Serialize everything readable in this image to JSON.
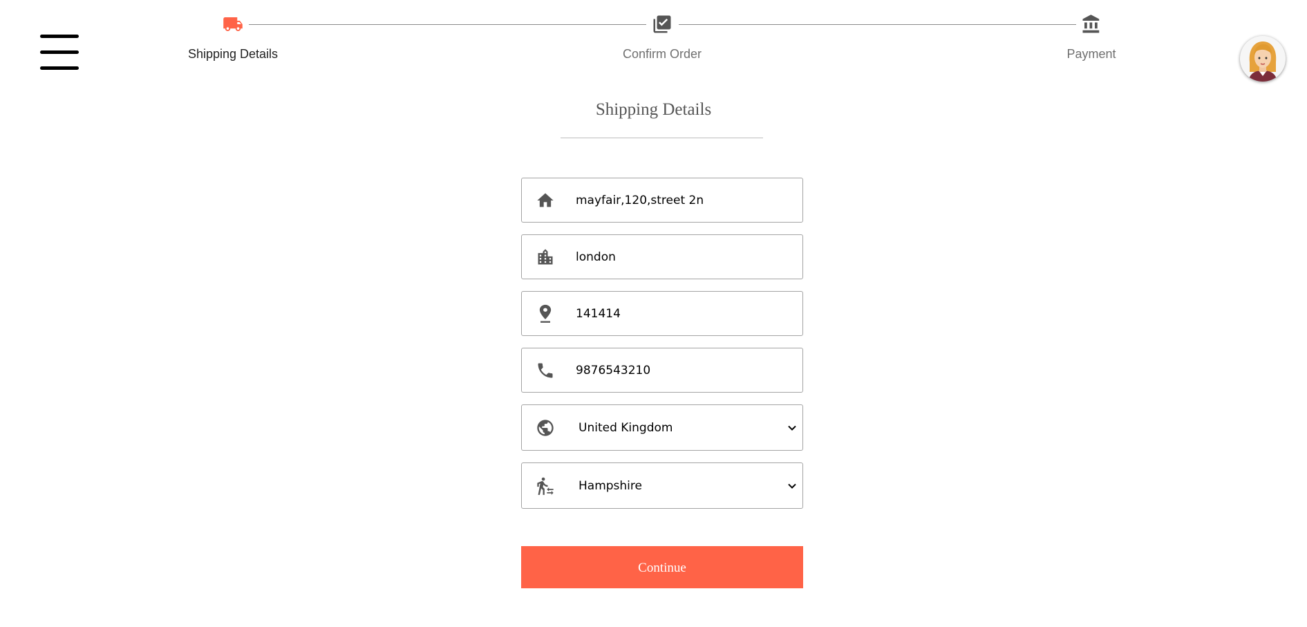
{
  "stepper": {
    "steps": [
      {
        "label": "Shipping Details",
        "icon": "truck-icon",
        "active": true
      },
      {
        "label": "Confirm Order",
        "icon": "checklist-icon",
        "active": false
      },
      {
        "label": "Payment",
        "icon": "bank-icon",
        "active": false
      }
    ]
  },
  "heading": "Shipping Details",
  "form": {
    "address": {
      "value": "mayfair,120,street 2n",
      "icon": "home-icon"
    },
    "city": {
      "value": "london",
      "icon": "city-icon"
    },
    "pincode": {
      "value": "141414",
      "icon": "location-pin-icon"
    },
    "phone": {
      "value": "9876543210",
      "icon": "phone-icon"
    },
    "country": {
      "value": "United Kingdom",
      "icon": "globe-icon"
    },
    "state": {
      "value": "Hampshire",
      "icon": "transfer-within-station-icon"
    }
  },
  "continue_label": "Continue",
  "colors": {
    "accent": "#ff6347",
    "icon_gray": "#555555",
    "active_step_icon": "#ff6347"
  }
}
